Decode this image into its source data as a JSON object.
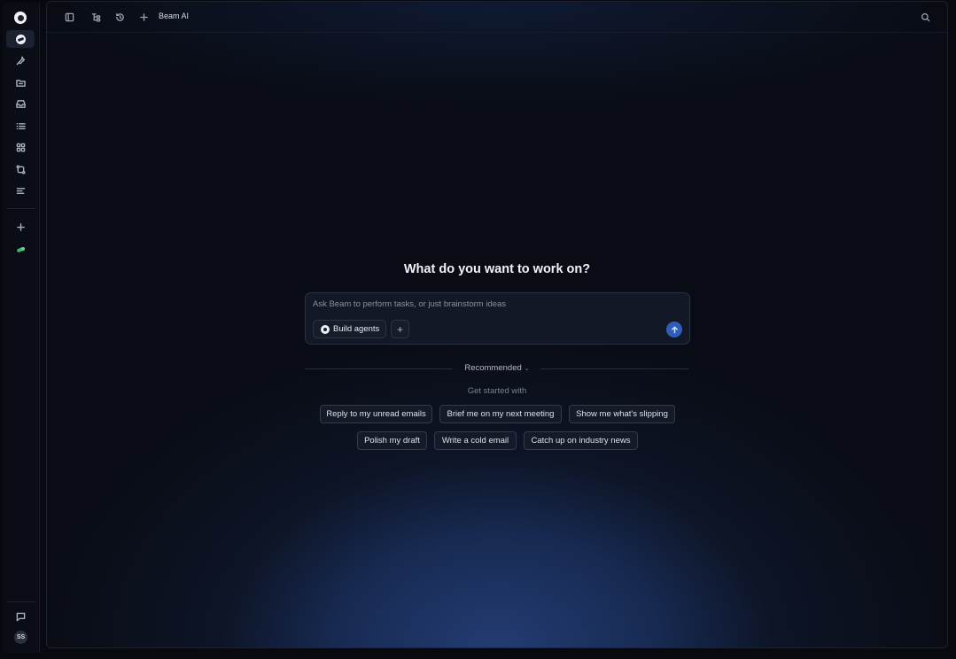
{
  "app": {
    "title": "Beam AI"
  },
  "sidebar": {
    "items": [
      {
        "icon": "beam-logo-icon",
        "active": true
      },
      {
        "icon": "wrench-icon"
      },
      {
        "icon": "folder-icon"
      },
      {
        "icon": "inbox-icon"
      },
      {
        "icon": "list-icon"
      },
      {
        "icon": "grid-icon"
      },
      {
        "icon": "transfer-icon"
      },
      {
        "icon": "text-lines-icon"
      },
      {
        "icon": "plus-icon"
      },
      {
        "icon": "integration-icon"
      }
    ],
    "footer": {
      "chat_icon": "chat-icon",
      "avatar_initials": "SS"
    }
  },
  "topbar": {
    "title": "Beam AI",
    "icons": [
      "sidebar-toggle-icon",
      "tree-icon",
      "history-icon",
      "plus-icon",
      "search-icon"
    ]
  },
  "main": {
    "heading": "What do you want to work on?",
    "composer": {
      "placeholder": "Ask Beam to perform tasks, or just brainstorm ideas",
      "build_agents_label": "Build agents",
      "add_label": "+"
    },
    "recommended": {
      "label": "Recommended",
      "subtitle": "Get started with",
      "suggestions": [
        "Reply to my unread emails",
        "Brief me on my next meeting",
        "Show me what's slipping",
        "Polish my draft",
        "Write a cold email",
        "Catch up on industry news"
      ]
    }
  },
  "colors": {
    "accent": "#2f5db8",
    "background": "#090c14",
    "glow": "#233c72"
  }
}
